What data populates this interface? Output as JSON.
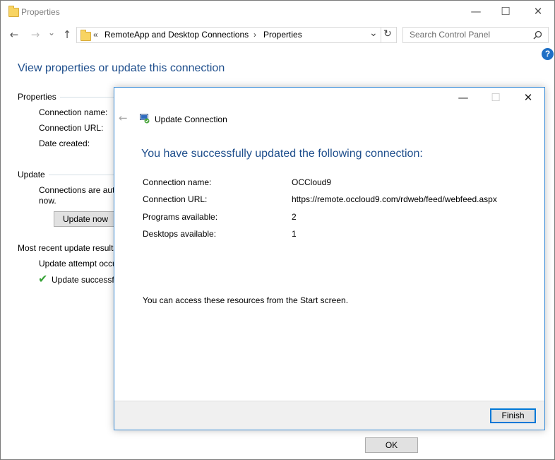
{
  "window": {
    "title": "Properties",
    "minimize_glyph": "—",
    "maximize_glyph": "☐",
    "close_glyph": "✕"
  },
  "nav": {
    "back_glyph": "←",
    "forward_glyph": "→",
    "recent_glyph": "⌄",
    "up_glyph": "↑",
    "breadcrumb_prefix": "«",
    "breadcrumb": [
      "RemoteApp and Desktop Connections",
      "Properties"
    ],
    "breadcrumb_separator": "›",
    "dropdown_glyph": "⌄",
    "refresh_glyph": "↻",
    "search_placeholder": "Search Control Panel",
    "search_icon": "magnifier-icon"
  },
  "main": {
    "heading": "View properties or update this connection",
    "properties_section": "Properties",
    "properties_labels": [
      "Connection name:",
      "Connection URL:",
      "Date created:"
    ],
    "update_section": "Update",
    "update_text_line1": "Connections are aut",
    "update_text_line2": "now.",
    "update_button": "Update now",
    "recent_section": "Most recent update results",
    "update_attempt": "Update attempt occu",
    "update_success": "Update successfu",
    "ok_button": "OK"
  },
  "dialog": {
    "title": "Update Connection",
    "heading": "You have successfully updated the following connection:",
    "rows": [
      {
        "label": "Connection name:",
        "value": "OCCloud9"
      },
      {
        "label": "Connection URL:",
        "value": "https://remote.occloud9.com/rdweb/feed/webfeed.aspx"
      },
      {
        "label": "Programs available:",
        "value": "2"
      },
      {
        "label": "Desktops available:",
        "value": "1"
      }
    ],
    "note": "You can access these resources from the Start screen.",
    "finish_button": "Finish",
    "minimize_glyph": "—",
    "maximize_glyph": "☐",
    "close_glyph": "✕",
    "back_glyph": "←"
  },
  "colors": {
    "heading_blue": "#1e4e8c",
    "dialog_border": "#3c8ed8",
    "success_green": "#3aa43a"
  }
}
